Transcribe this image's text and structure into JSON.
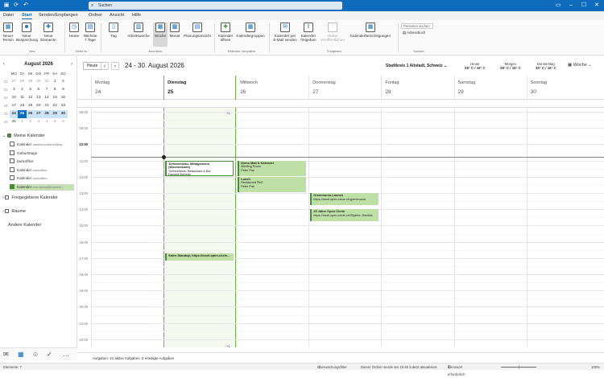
{
  "titlebar": {
    "search_placeholder": "Suchen",
    "icons": [
      "outlook-icon",
      "sync-icon",
      "undo-icon"
    ]
  },
  "menu": {
    "items": [
      "Datei",
      "Start",
      "Senden/Empfangen",
      "Ordner",
      "Ansicht",
      "Hilfe"
    ],
    "active": "Start"
  },
  "ribbon": {
    "neu": [
      "Neuer Termin",
      "Neue Besprechung",
      "Neue Elemente"
    ],
    "gehe_zu": [
      "Heute",
      "Nächste 7 Tage"
    ],
    "anordnen": [
      "Tag",
      "Arbeitswoche",
      "Woche",
      "Monat",
      "Planungsansicht"
    ],
    "verwalten": [
      "Kalender öffnen",
      "Kalendergruppen"
    ],
    "freigeben": [
      "Kalender per E-Mail senden",
      "Kalender freigeben",
      "Online veröffentlichen",
      "Kalenderberechtigungen"
    ],
    "suchen": [
      "Personen suchen",
      "Adressbuch"
    ],
    "groups": [
      "Neu",
      "Gehe zu",
      "Anordnen",
      "Kalender verwalten",
      "Freigeben",
      "Suchen"
    ]
  },
  "minical": {
    "title": "August 2026",
    "headers": [
      "MO",
      "DI",
      "MI",
      "DO",
      "FR",
      "SA",
      "SO"
    ],
    "weeks": [
      {
        "wk": "31",
        "days": [
          "27",
          "28",
          "29",
          "30",
          "31",
          "1",
          "2"
        ]
      },
      {
        "wk": "32",
        "days": [
          "3",
          "4",
          "5",
          "6",
          "7",
          "8",
          "9"
        ]
      },
      {
        "wk": "33",
        "days": [
          "10",
          "11",
          "12",
          "13",
          "14",
          "15",
          "16"
        ]
      },
      {
        "wk": "34",
        "days": [
          "17",
          "18",
          "19",
          "20",
          "21",
          "22",
          "23"
        ]
      },
      {
        "wk": "35",
        "days": [
          "24",
          "25",
          "26",
          "27",
          "28",
          "29",
          "30"
        ]
      },
      {
        "wk": "36",
        "days": [
          "31",
          "1",
          "2",
          "3",
          "4",
          "5",
          "6"
        ]
      }
    ],
    "today": "25"
  },
  "folders": {
    "my_calendars": "Meine Kalender",
    "items": [
      {
        "label": "Kalender",
        "sub": "daniela.siebertz@ep..."
      },
      {
        "label": "Geburtstage",
        "sub": ""
      },
      {
        "label": "backoffice",
        "sub": ""
      },
      {
        "label": "Kalender",
        "sub": "backoffice"
      },
      {
        "label": "Kalender",
        "sub": "backoffice"
      },
      {
        "label": "Kalender",
        "sub": "zoe.zebra@futurete..."
      }
    ],
    "shared": "Freigegebene Kalender",
    "rooms": "Räume",
    "other": "Andere Kalender"
  },
  "header": {
    "today_btn": "Heute",
    "range": "24 - 30. August 2026",
    "location": "Stadtkreis 1 Altstadt, Schweiz",
    "weather": [
      {
        "day": "Heute",
        "temp": "25° C / 16° C"
      },
      {
        "day": "Morgen",
        "temp": "28° C / 16° C"
      },
      {
        "day": "Donnerstag",
        "temp": "30° C / 16° C"
      }
    ],
    "view": "Woche"
  },
  "days": [
    {
      "name": "Montag",
      "date": "24"
    },
    {
      "name": "Dienstag",
      "date": "25"
    },
    {
      "name": "Mittwoch",
      "date": "26"
    },
    {
      "name": "Donnerstag",
      "date": "27"
    },
    {
      "name": "Freitag",
      "date": "28"
    },
    {
      "name": "Samstag",
      "date": "29"
    },
    {
      "name": "Sonntag",
      "date": "30"
    }
  ],
  "hours": [
    "08:00",
    "09:00",
    "10:00",
    "11:00",
    "12:00",
    "13:00",
    "14:00",
    "15:00",
    "16:00",
    "17:00",
    "18:00",
    "19:00",
    "20:00",
    "21:00",
    "22:00"
  ],
  "events": {
    "tue_1": {
      "title": "Turbinenbräu, Mittagsmenü (Wochenkarte)",
      "line2": "Turbinenbräu Restaurant & Bar",
      "line3": "Daniela Siebertz"
    },
    "tue_2": {
      "title": "Sales Standup; https://meet.open-circle..."
    },
    "wed_1": {
      "title": "Demo Mail & Kalender",
      "line2": "Meeting Room",
      "line3": "Peter Pan"
    },
    "wed_2": {
      "title": "Lunch",
      "line2": "Restaurant Pirl2",
      "line3": "Peter Pan"
    },
    "thu_1": {
      "title": "Gremmunio-Launch",
      "line2": "https://meet.open-circle.ch/gremmunio"
    },
    "thu_2": {
      "title": "25 Jahre Open Circle",
      "line2": "https://meet.open-circle.ch/25jahre; Daniela"
    }
  },
  "more_badges": [
    "+1",
    "+1"
  ],
  "tasks": "Aufgaben: 24 aktive Aufgaben, 0 erledigte Aufgaben",
  "status": {
    "elements": "Elemente: 7",
    "filter": "Überwachungsfilter",
    "updated": "Dieser Ordner wurde am 19:46 zuletzt aktualisiert.",
    "password": "Kennwort erforderlich",
    "zoom": "100%"
  }
}
